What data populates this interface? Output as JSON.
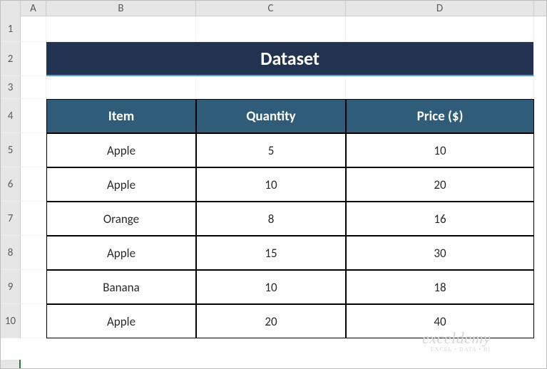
{
  "columns": [
    "A",
    "B",
    "C",
    "D"
  ],
  "rowNumbers": [
    "1",
    "2",
    "3",
    "4",
    "5",
    "6",
    "7",
    "8",
    "9",
    "10"
  ],
  "title": "Dataset",
  "headers": {
    "item": "Item",
    "quantity": "Quantity",
    "price": "Price ($)"
  },
  "rows": [
    {
      "item": "Apple",
      "quantity": "5",
      "price": "10"
    },
    {
      "item": "Apple",
      "quantity": "10",
      "price": "20"
    },
    {
      "item": "Orange",
      "quantity": "8",
      "price": "16"
    },
    {
      "item": "Apple",
      "quantity": "15",
      "price": "30"
    },
    {
      "item": "Banana",
      "quantity": "10",
      "price": "18"
    },
    {
      "item": "Apple",
      "quantity": "20",
      "price": "40"
    }
  ],
  "watermark": {
    "brand": "exceldemy",
    "tagline": "EXCEL • DATA • BI"
  },
  "chart_data": {
    "type": "table",
    "title": "Dataset",
    "columns": [
      "Item",
      "Quantity",
      "Price ($)"
    ],
    "data": [
      [
        "Apple",
        5,
        10
      ],
      [
        "Apple",
        10,
        20
      ],
      [
        "Orange",
        8,
        16
      ],
      [
        "Apple",
        15,
        30
      ],
      [
        "Banana",
        10,
        18
      ],
      [
        "Apple",
        20,
        40
      ]
    ]
  }
}
